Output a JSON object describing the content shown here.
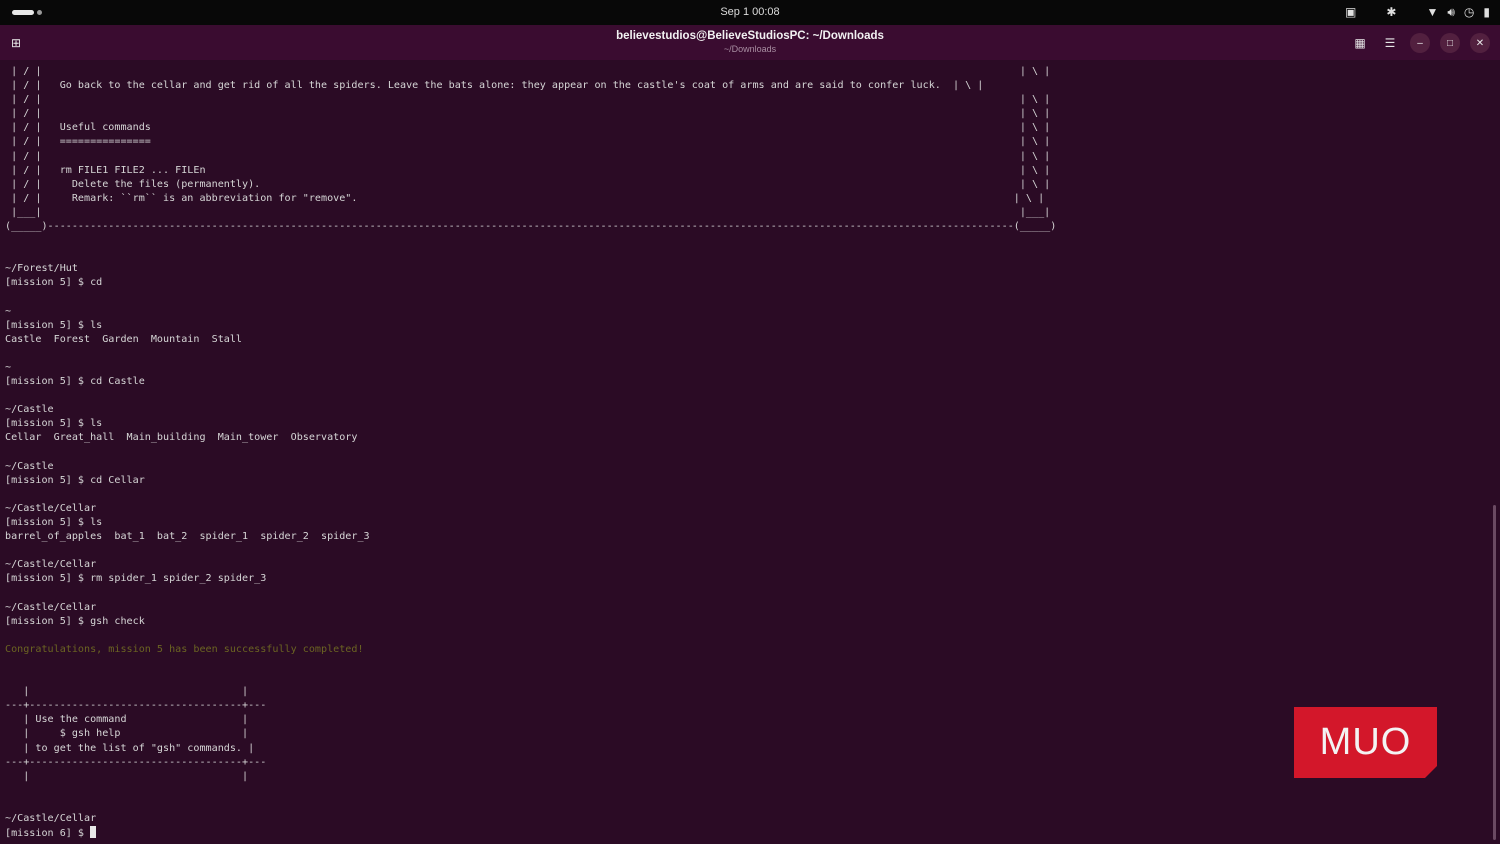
{
  "topbar": {
    "clock": "Sep 1  00:08"
  },
  "window": {
    "title": "believestudios@BelieveStudiosPC: ~/Downloads",
    "subtitle": "~/Downloads"
  },
  "terminal": {
    "lines": [
      " | / |                                                                                                                                                                 | \\ |",
      " | / |   Go back to the cellar and get rid of all the spiders. Leave the bats alone: they appear on the castle's coat of arms and are said to confer luck.  | \\ |",
      " | / |                                                                                                                                                                 | \\ |",
      " | / |                                                                                                                                                                 | \\ |",
      " | / |   Useful commands                                                                                                                                               | \\ |",
      " | / |   ===============                                                                                                                                               | \\ |",
      " | / |                                                                                                                                                                 | \\ |",
      " | / |   rm FILE1 FILE2 ... FILEn                                                                                                                                      | \\ |",
      " | / |     Delete the files (permanently).                                                                                                                             | \\ |",
      " | / |     Remark: ``rm`` is an abbreviation for \"remove\".                                                                                                            | \\ |",
      " |___|                                                                                                                                                                 |___|",
      "(_____)---------------------------------------------------------------------------------------------------------------------------------------------------------------(_____)",
      "",
      "",
      "~/Forest/Hut",
      "[mission 5] $ cd",
      "",
      "~",
      "[mission 5] $ ls",
      "Castle  Forest  Garden  Mountain  Stall",
      "",
      "~",
      "[mission 5] $ cd Castle",
      "",
      "~/Castle",
      "[mission 5] $ ls",
      "Cellar  Great_hall  Main_building  Main_tower  Observatory",
      "",
      "~/Castle",
      "[mission 5] $ cd Cellar",
      "",
      "~/Castle/Cellar",
      "[mission 5] $ ls",
      "barrel_of_apples  bat_1  bat_2  spider_1  spider_2  spider_3",
      "",
      "~/Castle/Cellar",
      "[mission 5] $ rm spider_1 spider_2 spider_3",
      "",
      "~/Castle/Cellar",
      "[mission 5] $ gsh check",
      "",
      "Congratulations, mission 5 has been successfully completed!",
      "",
      "",
      "   |                                   |",
      "---+-----------------------------------+---",
      "   | Use the command                   |",
      "   |     $ gsh help                    |",
      "   | to get the list of \"gsh\" commands. |",
      "---+-----------------------------------+---",
      "   |                                   |",
      "",
      "",
      "~/Castle/Cellar",
      "[mission 6] $ "
    ],
    "success_line_index": 41,
    "success_color": "#6b6422"
  },
  "watermark": {
    "text": "MUO",
    "color": "#d3172a"
  },
  "icons": {
    "new_tab": "new-tab-icon",
    "grid": "grid-view-icon",
    "menu": "hamburger-menu-icon",
    "minimize": "minimize-icon",
    "maximize": "maximize-icon",
    "close": "close-icon"
  }
}
